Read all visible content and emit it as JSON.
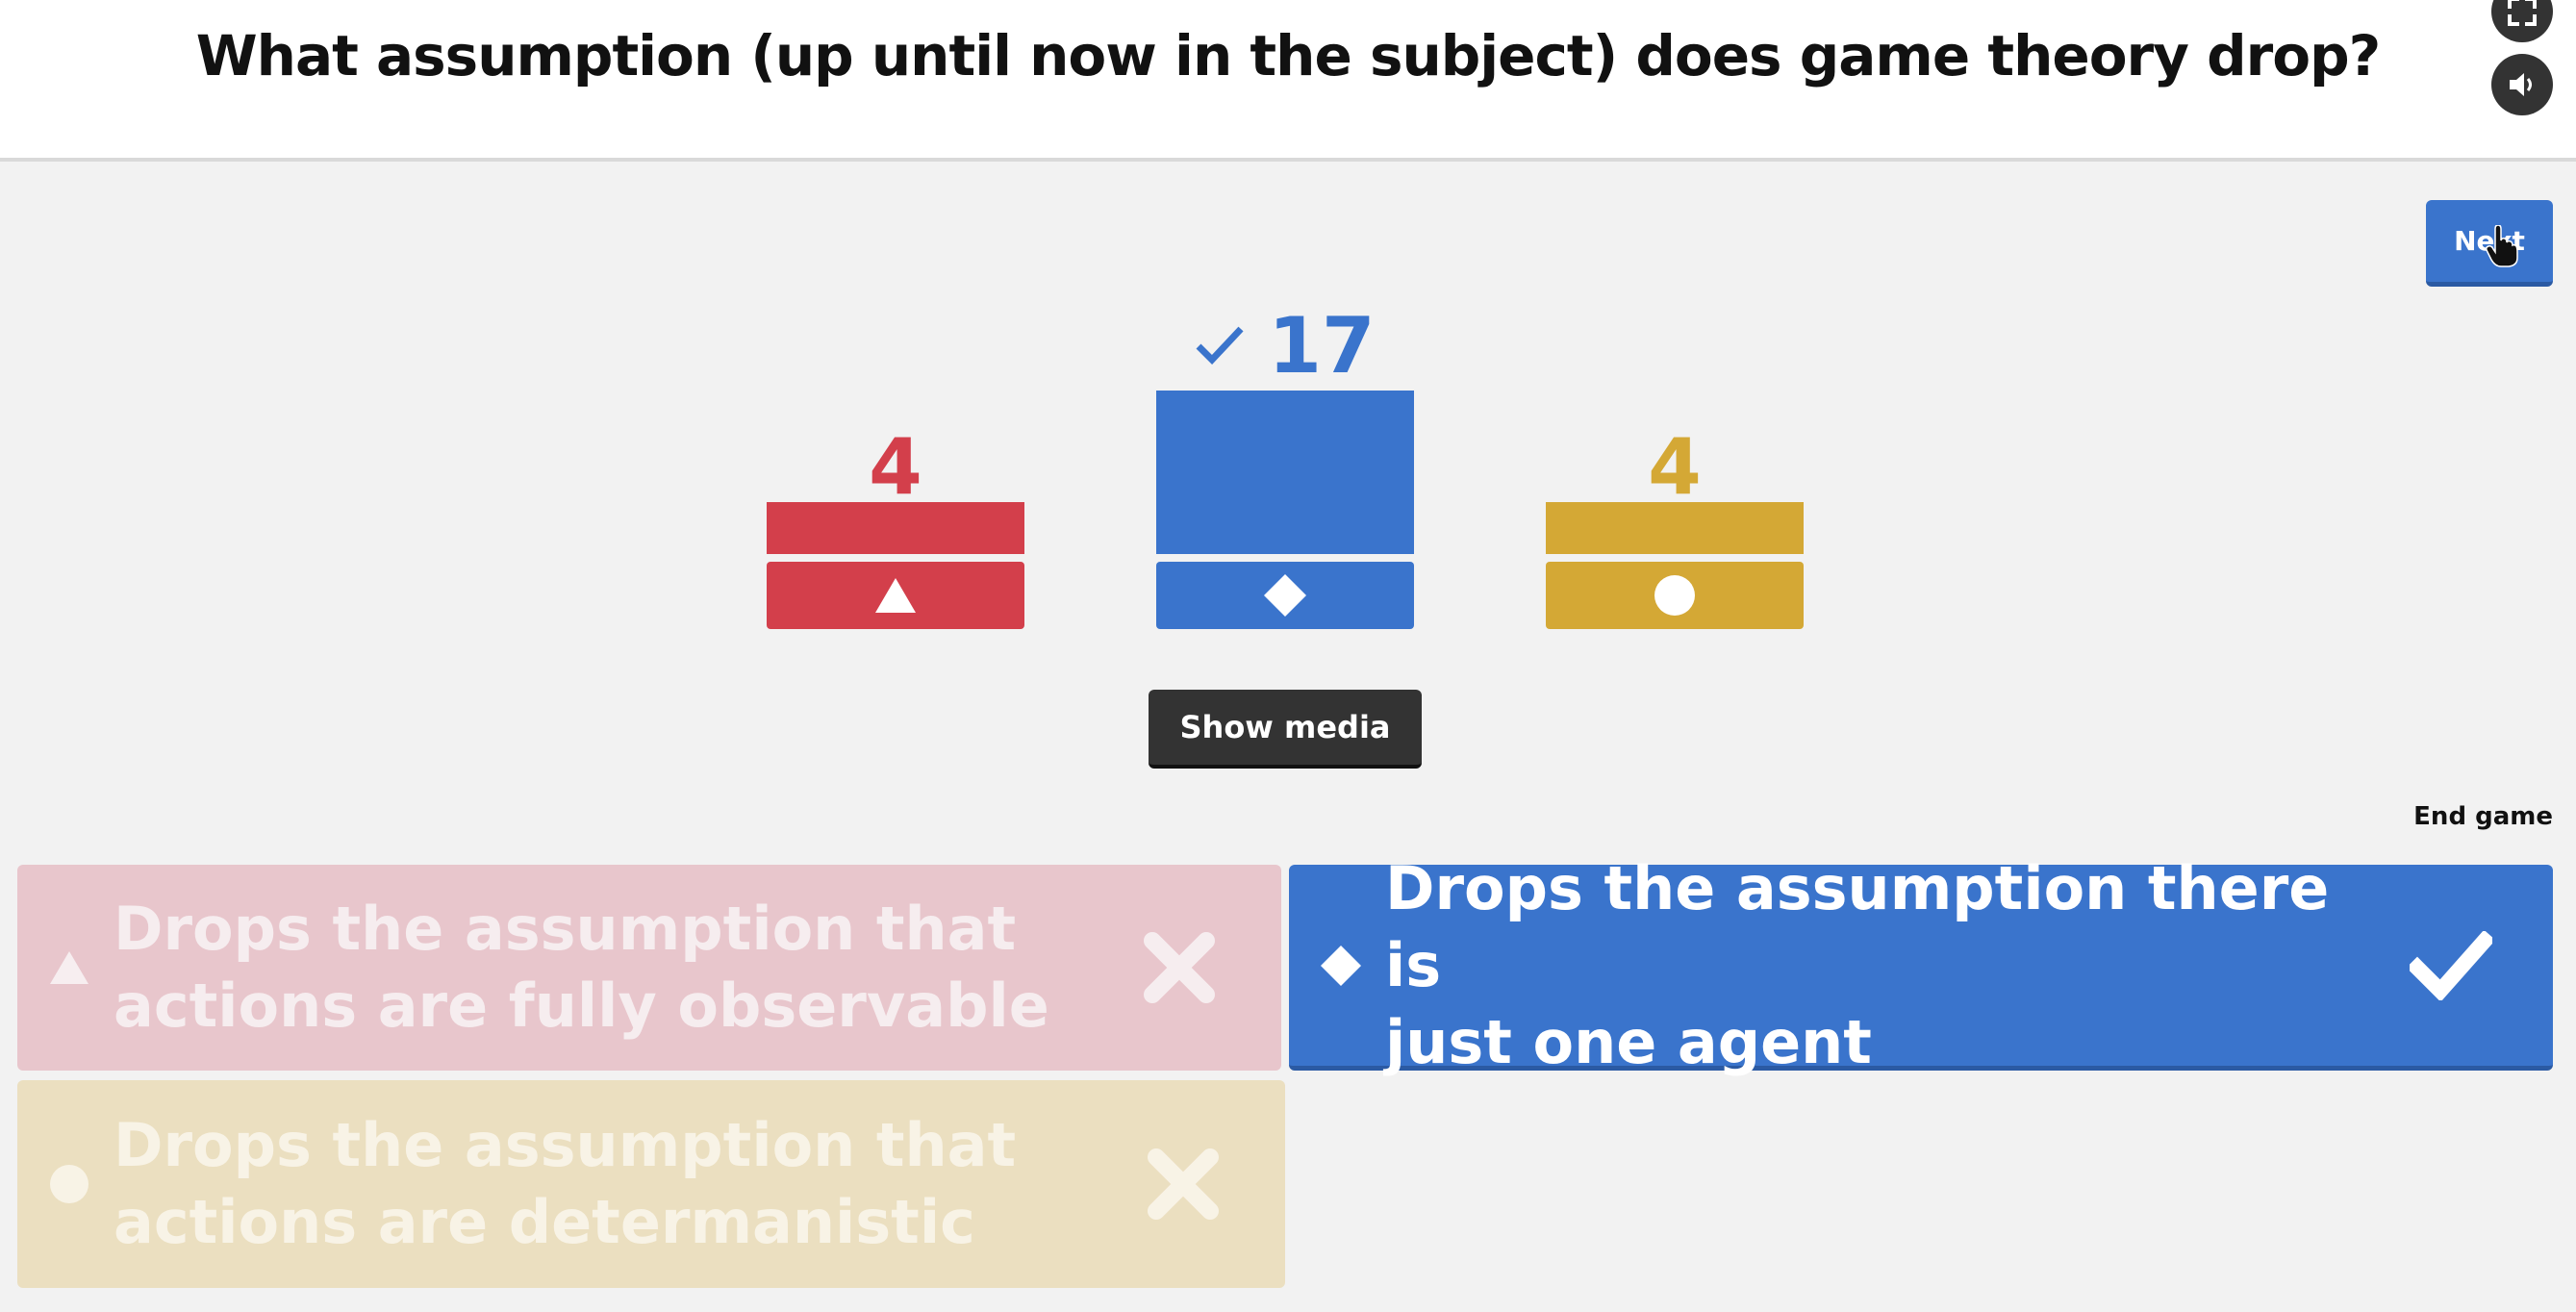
{
  "question": "What assumption (up until now in the subject) does game theory drop?",
  "header_buttons": {
    "fullscreen_icon": "fullscreen-icon",
    "sound_icon": "sound-icon"
  },
  "next_label": "Next",
  "results": {
    "max_count": 17,
    "bars": [
      {
        "shape": "triangle",
        "count": "4",
        "value": 4,
        "color": "#d33f4b",
        "correct": false
      },
      {
        "shape": "diamond",
        "count": "17",
        "value": 17,
        "color": "#3a74cc",
        "correct": true
      },
      {
        "shape": "circle",
        "count": "4",
        "value": 4,
        "color": "#d4a835",
        "correct": false
      }
    ]
  },
  "show_media_label": "Show media",
  "end_game_label": "End game",
  "answers": [
    {
      "shape": "triangle",
      "line1": "Drops the assumption that",
      "line2": "actions are fully observable",
      "correct": false,
      "bg": "#e8c6cc"
    },
    {
      "shape": "diamond",
      "line1": "Drops the assumption there is",
      "line2": "just one agent",
      "correct": true,
      "bg": "#3a74cc"
    },
    {
      "shape": "circle",
      "line1": "Drops the assumption that",
      "line2": "actions are determanistic",
      "correct": false,
      "bg": "#ebdfc0"
    }
  ]
}
